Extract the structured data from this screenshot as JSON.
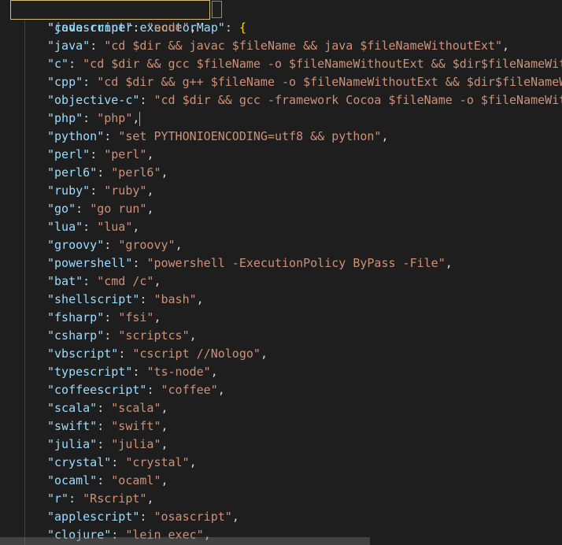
{
  "editor": {
    "top_key": "\"code-runner.executorMap\"",
    "top_colon": ": ",
    "open_brace": "{",
    "entries": [
      {
        "key": "\"javascript\"",
        "value": "\"node\"",
        "tail": ","
      },
      {
        "key": "\"java\"",
        "value": "\"cd $dir && javac $fileName && java $fileNameWithoutExt\"",
        "tail": ","
      },
      {
        "key": "\"c\"",
        "value": "\"cd $dir && gcc $fileName -o $fileNameWithoutExt && $dir$fileNameWithoutExt\"",
        "tail": ","
      },
      {
        "key": "\"cpp\"",
        "value": "\"cd $dir && g++ $fileName -o $fileNameWithoutExt && $dir$fileNameWithoutExt\"",
        "tail": ","
      },
      {
        "key": "\"objective-c\"",
        "value": "\"cd $dir && gcc -framework Cocoa $fileName -o $fileNameWithoutExt && $dir$fileNameWithoutExt\"",
        "tail": ","
      },
      {
        "key": "\"php\"",
        "value": "\"php\"",
        "tail": ","
      },
      {
        "key": "\"python\"",
        "value": "\"set PYTHONIOENCODING=utf8 && python\"",
        "tail": ","
      },
      {
        "key": "\"perl\"",
        "value": "\"perl\"",
        "tail": ","
      },
      {
        "key": "\"perl6\"",
        "value": "\"perl6\"",
        "tail": ","
      },
      {
        "key": "\"ruby\"",
        "value": "\"ruby\"",
        "tail": ","
      },
      {
        "key": "\"go\"",
        "value": "\"go run\"",
        "tail": ","
      },
      {
        "key": "\"lua\"",
        "value": "\"lua\"",
        "tail": ","
      },
      {
        "key": "\"groovy\"",
        "value": "\"groovy\"",
        "tail": ","
      },
      {
        "key": "\"powershell\"",
        "value": "\"powershell -ExecutionPolicy ByPass -File\"",
        "tail": ","
      },
      {
        "key": "\"bat\"",
        "value": "\"cmd /c\"",
        "tail": ","
      },
      {
        "key": "\"shellscript\"",
        "value": "\"bash\"",
        "tail": ","
      },
      {
        "key": "\"fsharp\"",
        "value": "\"fsi\"",
        "tail": ","
      },
      {
        "key": "\"csharp\"",
        "value": "\"scriptcs\"",
        "tail": ","
      },
      {
        "key": "\"vbscript\"",
        "value": "\"cscript //Nologo\"",
        "tail": ","
      },
      {
        "key": "\"typescript\"",
        "value": "\"ts-node\"",
        "tail": ","
      },
      {
        "key": "\"coffeescript\"",
        "value": "\"coffee\"",
        "tail": ","
      },
      {
        "key": "\"scala\"",
        "value": "\"scala\"",
        "tail": ","
      },
      {
        "key": "\"swift\"",
        "value": "\"swift\"",
        "tail": ","
      },
      {
        "key": "\"julia\"",
        "value": "\"julia\"",
        "tail": ","
      },
      {
        "key": "\"crystal\"",
        "value": "\"crystal\"",
        "tail": ","
      },
      {
        "key": "\"ocaml\"",
        "value": "\"ocaml\"",
        "tail": ","
      },
      {
        "key": "\"r\"",
        "value": "\"Rscript\"",
        "tail": ","
      },
      {
        "key": "\"applescript\"",
        "value": "\"osascript\"",
        "tail": ","
      },
      {
        "key": "\"clojure\"",
        "value": "\"lein exec\"",
        "tail": ","
      }
    ]
  },
  "colors": {
    "background": "#1e1e1e",
    "json_key": "#9cdcfe",
    "json_string": "#ce9178",
    "bracket": "#ffd700",
    "highlight_border": "#d7ba7d"
  }
}
